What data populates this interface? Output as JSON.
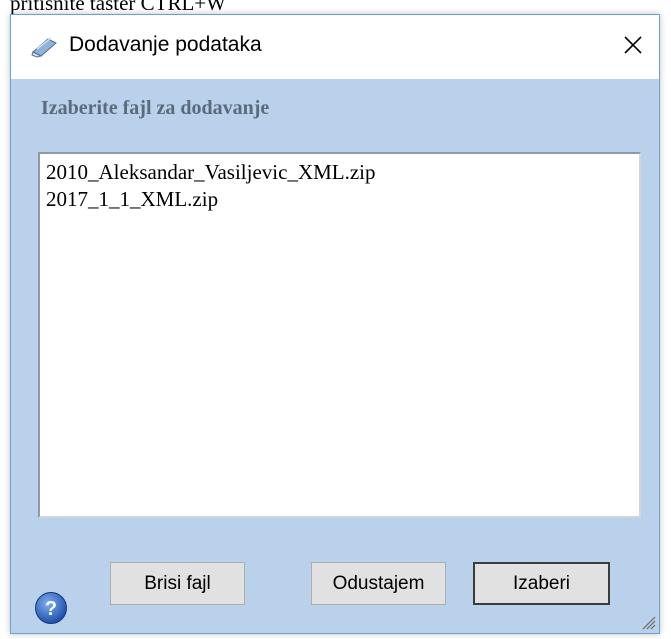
{
  "background": {
    "partial_text": "pritisnite taster CTRL+W"
  },
  "dialog": {
    "title": "Dodavanje podataka",
    "title_icon": "pencil-eraser-icon",
    "close_icon": "close-icon",
    "prompt": "Izaberite fajl za dodavanje",
    "files": [
      "2010_Aleksandar_Vasiljevic_XML.zip",
      "2017_1_1_XML.zip"
    ],
    "buttons": {
      "delete": "Brisi fajl",
      "cancel": "Odustajem",
      "select": "Izaberi"
    },
    "help_icon": "help-icon",
    "colors": {
      "dialog_bg": "#b9d1ea",
      "label": "#5a6b7c",
      "button_bg": "#e1e1e1"
    }
  }
}
